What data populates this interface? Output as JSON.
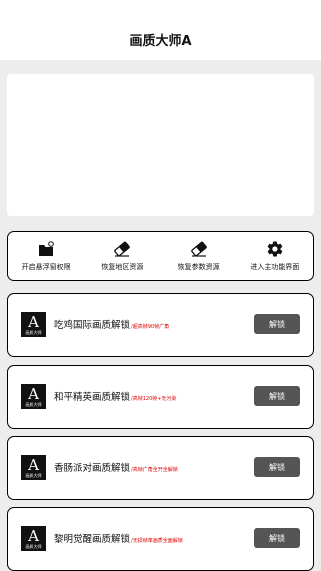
{
  "header": {
    "title": "画质大师A"
  },
  "toolbar": {
    "items": [
      {
        "label": "开启悬浮窗权限",
        "icon": "folder-icon"
      },
      {
        "label": "恢复地区资源",
        "icon": "eraser-icon"
      },
      {
        "label": "恢复参数资源",
        "icon": "eraser-icon"
      },
      {
        "label": "进入主功能界面",
        "icon": "gear-icon"
      }
    ]
  },
  "cards": [
    {
      "logo_big": "A",
      "logo_small": "画质大师",
      "name": "吃鸡国际画质解锁",
      "note": "/超高帧90帧广角",
      "button": "解锁"
    },
    {
      "logo_big": "A",
      "logo_small": "画质大师",
      "name": "和平精英画质解锁",
      "note": "/高帧120帧+无污染",
      "button": "解锁"
    },
    {
      "logo_big": "A",
      "logo_small": "画质大师",
      "name": "香肠派对画质解锁",
      "note": "/高帧广角全开全解锁",
      "button": "解锁"
    },
    {
      "logo_big": "A",
      "logo_small": "画质大师",
      "name": "黎明觉醒画质解锁",
      "note": "/无损帧率画质全面解锁",
      "button": "解锁"
    }
  ]
}
